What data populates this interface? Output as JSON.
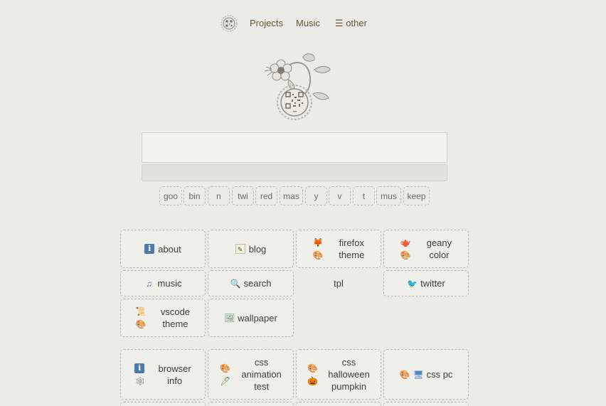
{
  "nav": {
    "logo_icon": "qr-gear-logo-icon",
    "links": [
      {
        "label": "Projects"
      },
      {
        "label": "Music"
      },
      {
        "label": "☰ other"
      }
    ]
  },
  "hero": {
    "logo_icon": "flower-vine-qr-logo-icon"
  },
  "search": {
    "value": "",
    "placeholder": ""
  },
  "chips": [
    "goo",
    "bin",
    "n",
    "twi",
    "red",
    "mas",
    "y",
    "v",
    "t",
    "mus",
    "keep"
  ],
  "tiles_group1": [
    {
      "label": "about",
      "icons": [
        "info-icon"
      ]
    },
    {
      "label": "blog",
      "icons": [
        "memo-icon"
      ]
    },
    {
      "label": "firefox\ntheme",
      "icons": [
        "fox-icon",
        "palette-icon"
      ]
    },
    {
      "label": "geany\ncolor",
      "icons": [
        "teapot-icon",
        "palette-icon"
      ]
    },
    {
      "label": "music",
      "icons": [
        "music-notes-icon"
      ]
    },
    {
      "label": "search",
      "icons": [
        "magnifier-icon"
      ]
    },
    {
      "label": "tpl",
      "icons": []
    },
    {
      "label": "twitter",
      "icons": [
        "bird-icon"
      ]
    },
    {
      "label": "vscode\ntheme",
      "icons": [
        "scroll-icon",
        "palette-icon"
      ]
    },
    {
      "label": "wallpaper",
      "icons": [
        "framed-picture-icon"
      ]
    }
  ],
  "tiles_group2": [
    {
      "label": "browser\ninfo",
      "icons": [
        "info-icon",
        "web-icon"
      ]
    },
    {
      "label": "css\nanimation\ntest",
      "icons": [
        "palette-icon",
        "brush-icon"
      ]
    },
    {
      "label": "css\nhalloween\npumpkin",
      "icons": [
        "palette-icon",
        "pumpkin-icon"
      ]
    },
    {
      "label": "css pc",
      "icons": [
        "palette-icon",
        "computer-icon"
      ]
    }
  ],
  "colors": {
    "background": "#ecece6",
    "tile_bg": "#f0f0ea",
    "nav_link": "#6b5533",
    "tile_border": "#b9b9b1"
  }
}
